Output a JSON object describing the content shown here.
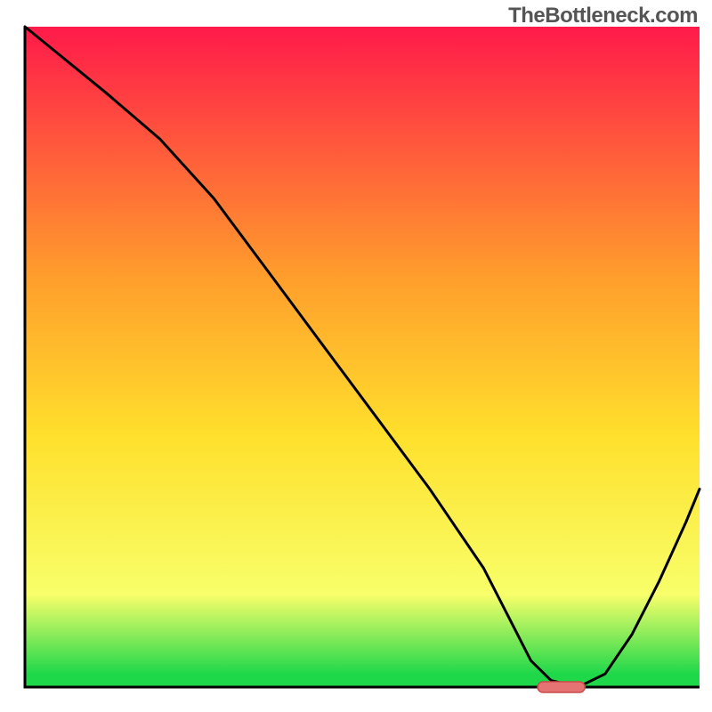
{
  "watermark": "TheBottleneck.com",
  "colors": {
    "grad_top": "#ff1a4a",
    "grad_upper_mid": "#ff9e2c",
    "grad_mid": "#ffe02c",
    "grad_lower_mid": "#f8ff6a",
    "grad_green": "#1fd84a",
    "line": "#000000",
    "axis": "#000000",
    "marker_fill": "#e57373",
    "marker_stroke": "#c84b4b"
  },
  "chart_data": {
    "type": "line",
    "title": "",
    "xlabel": "",
    "ylabel": "",
    "xlim": [
      0,
      100
    ],
    "ylim": [
      0,
      100
    ],
    "series": [
      {
        "name": "curve",
        "x": [
          0,
          12,
          20,
          28,
          36,
          44,
          52,
          60,
          68,
          72,
          75,
          78,
          82,
          86,
          90,
          94,
          98,
          100
        ],
        "values": [
          100,
          90,
          83,
          74,
          63,
          52,
          41,
          30,
          18,
          10,
          4,
          1,
          0,
          2,
          8,
          16,
          25,
          30
        ]
      }
    ],
    "marker": {
      "x_start": 76,
      "x_end": 83,
      "y": 0
    }
  }
}
